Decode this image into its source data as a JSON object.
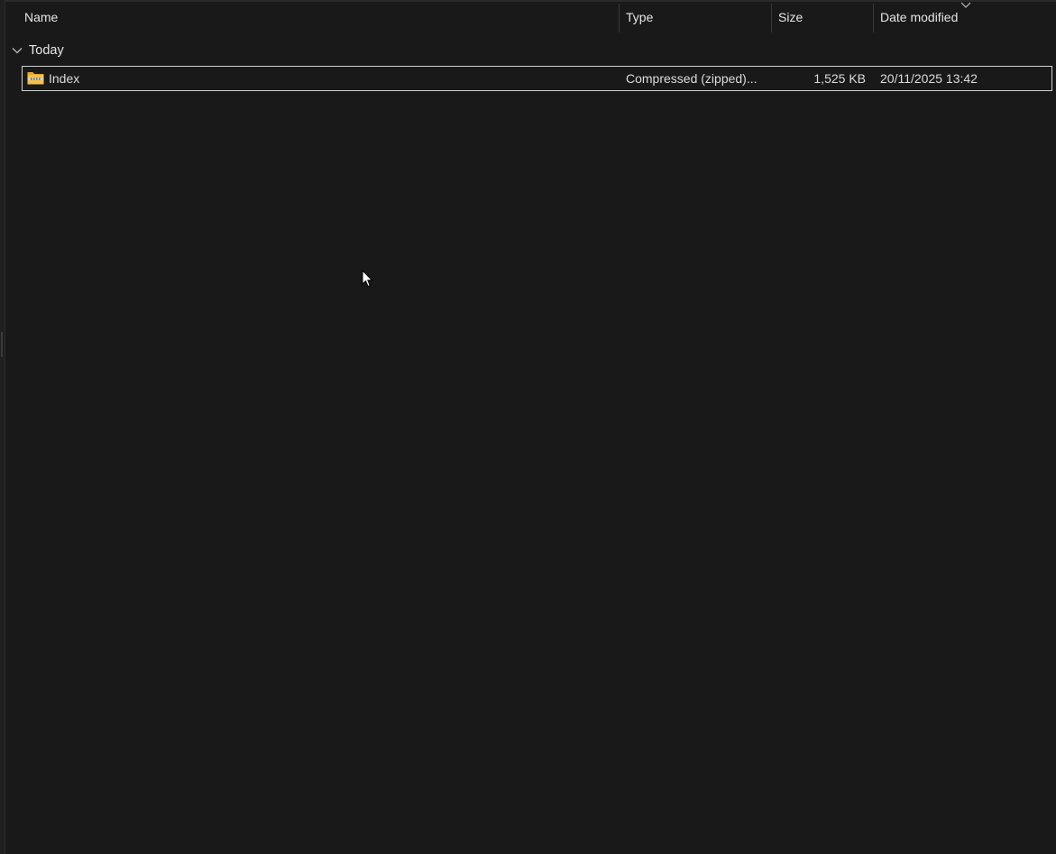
{
  "columns": {
    "name": "Name",
    "type": "Type",
    "size": "Size",
    "date": "Date modified"
  },
  "groups": [
    {
      "label": "Today",
      "items": [
        {
          "name": "Index",
          "type": "Compressed (zipped)...",
          "size": "1,525 KB",
          "date": "20/11/2025 13:42",
          "icon": "zip-folder-icon"
        }
      ]
    }
  ],
  "colors": {
    "background": "#191919",
    "text": "#dcdcdc",
    "folder": "#f3c14b",
    "selection_border": "#d0d0d0"
  }
}
